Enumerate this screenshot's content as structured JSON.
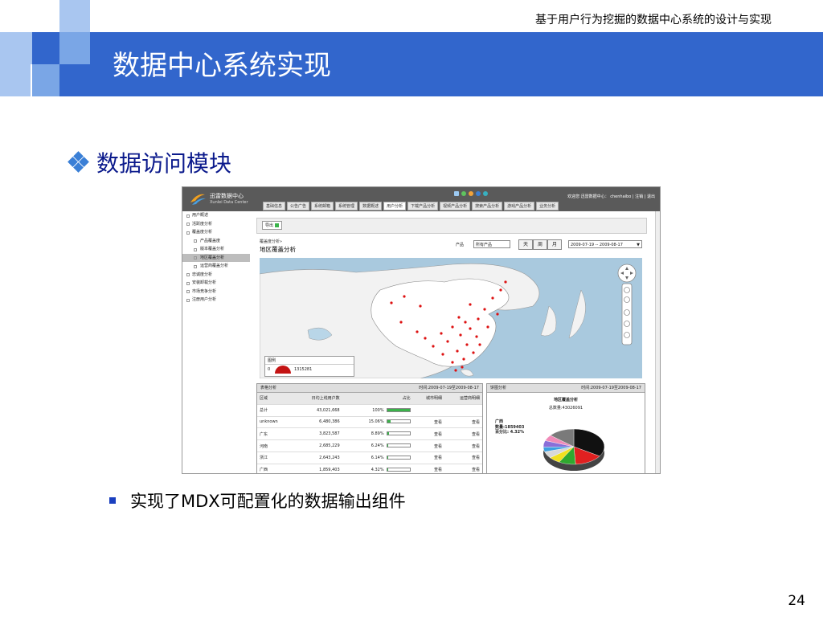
{
  "slide": {
    "header_text": "基于用户行为挖掘的数据中心系统的设计与实现",
    "title": "数据中心系统实现",
    "section_heading": "数据访问模块",
    "bullet_text": "实现了MDX可配置化的数据输出组件",
    "page_number": "24",
    "title_band_color": "#3266cc",
    "heading_color": "#0b1a8c"
  },
  "app": {
    "name": "迅雷数据中心",
    "subtitle": "Xunlei Data Center",
    "user_text": "欢迎您   迅雷数据中心： chenhaibo  | 注销 | 退出",
    "nav_tabs": [
      {
        "label": "基础信息",
        "active": false
      },
      {
        "label": "公告广告",
        "active": false
      },
      {
        "label": "系统邮箱",
        "active": false
      },
      {
        "label": "系统管理",
        "active": false
      },
      {
        "label": "数据概述",
        "active": false
      },
      {
        "label": "用户分析",
        "active": true
      },
      {
        "label": "下载产品分析",
        "active": false
      },
      {
        "label": "视频产品分析",
        "active": false
      },
      {
        "label": "搜索产品分析",
        "active": false
      },
      {
        "label": "游戏产品分析",
        "active": false
      },
      {
        "label": "业务分析",
        "active": false
      }
    ],
    "sidebar": [
      {
        "label": "用户概述",
        "level": 0,
        "active": false
      },
      {
        "label": "活跃度分析",
        "level": 0,
        "active": false
      },
      {
        "label": "覆盖度分析",
        "level": 0,
        "active": false
      },
      {
        "label": "产品覆盖度",
        "level": 1,
        "active": false
      },
      {
        "label": "版本覆盖分析",
        "level": 1,
        "active": false
      },
      {
        "label": "地区覆盖分析",
        "level": 1,
        "active": true
      },
      {
        "label": "运营商覆盖分析",
        "level": 1,
        "active": false
      },
      {
        "label": "忠诚度分析",
        "level": 0,
        "active": false
      },
      {
        "label": "安装卸载分析",
        "level": 0,
        "active": false
      },
      {
        "label": "市场竞争分析",
        "level": 0,
        "active": false
      },
      {
        "label": "注册用户分析",
        "level": 0,
        "active": false
      }
    ],
    "toolbar": {
      "export_label": "导出"
    },
    "breadcrumb": "覆盖度分析»",
    "panel_title": "地区覆盖分析",
    "filters": {
      "product_label": "产品",
      "product_value": "所有产品",
      "periods": [
        "天",
        "周",
        "月"
      ],
      "date_range": "2009-07-19 -- 2009-08-17"
    },
    "map_legend": {
      "title": "图例",
      "min": "0",
      "max": "1315281"
    },
    "table_panel": {
      "title": "表格分析",
      "time": "时间:2009-07-19至2009-08-17",
      "columns": [
        "区域",
        "日均上线用户数",
        "占比",
        "城市明细",
        "运营商明细"
      ],
      "rows": [
        {
          "region": "总计",
          "users": "43,021,668",
          "share": "100%",
          "share_pct": 100,
          "city": "",
          "isp": ""
        },
        {
          "region": "unknown",
          "users": "6,480,386",
          "share": "15.06%",
          "share_pct": 15.06,
          "city": "查看",
          "isp": "查看"
        },
        {
          "region": "广东",
          "users": "3,823,587",
          "share": "8.89%",
          "share_pct": 8.89,
          "city": "查看",
          "isp": "查看"
        },
        {
          "region": "河南",
          "users": "2,685,229",
          "share": "6.24%",
          "share_pct": 6.24,
          "city": "查看",
          "isp": "查看"
        },
        {
          "region": "浙江",
          "users": "2,643,243",
          "share": "6.14%",
          "share_pct": 6.14,
          "city": "查看",
          "isp": "查看"
        },
        {
          "region": "广西",
          "users": "1,859,403",
          "share": "4.32%",
          "share_pct": 4.32,
          "city": "查看",
          "isp": "查看"
        }
      ]
    },
    "pie_panel": {
      "title": "饼图分析",
      "time": "时间:2009-07-19至2009-08-17",
      "chart_title": "地区覆盖分析",
      "total": "总数量:43026091",
      "tooltip_region": "广西",
      "tooltip_count": "数量:1859403",
      "tooltip_share": "百分比: 4.32%",
      "slices": [
        {
          "value": 34.0,
          "color": "#111111"
        },
        {
          "value": 15.1,
          "color": "#e02020"
        },
        {
          "value": 8.9,
          "color": "#2fa82f"
        },
        {
          "value": 6.2,
          "color": "#f0e020"
        },
        {
          "value": 6.1,
          "color": "#d8d8d8"
        },
        {
          "value": 4.3,
          "color": "#3da0e0"
        },
        {
          "value": 6.0,
          "color": "#8a6ed8"
        },
        {
          "value": 5.5,
          "color": "#f08ab8"
        },
        {
          "value": 13.9,
          "color": "#7a7a7a"
        }
      ]
    }
  }
}
